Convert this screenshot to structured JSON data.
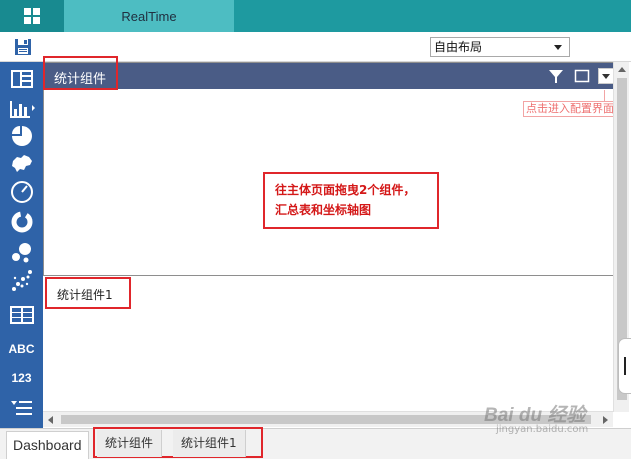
{
  "topbar": {
    "tab_label": "RealTime"
  },
  "toolbar": {
    "layout_value": "自由布局"
  },
  "sidebar": {
    "items": [
      {
        "icon": "table-layout-icon"
      },
      {
        "icon": "bar-chart-icon"
      },
      {
        "icon": "pie-chart-icon"
      },
      {
        "icon": "map-icon"
      },
      {
        "icon": "gauge-icon"
      },
      {
        "icon": "ring-chart-icon"
      },
      {
        "icon": "bubble-chart-icon"
      },
      {
        "icon": "scatter-chart-icon"
      },
      {
        "icon": "grid-table-icon"
      },
      {
        "label": "ABC"
      },
      {
        "label": "123"
      },
      {
        "icon": "list-filter-icon"
      }
    ]
  },
  "widget1": {
    "title": "统计组件",
    "config_hint": "点击进入配置界面",
    "note_line1": "往主体页面拖曳2个组件，",
    "note_line2": "汇总表和坐标轴图"
  },
  "widget2": {
    "title": "统计组件1"
  },
  "bottom_tabs": {
    "dashboard": "Dashboard",
    "tab1": "统计组件",
    "tab2": "统计组件1"
  },
  "watermark": {
    "text": "Bai du 经验",
    "sub": "jingyan.baidu.com"
  },
  "colors": {
    "topbar": "#1e9aa0",
    "sidebar": "#2f63a8",
    "widget_header": "#4a5c86",
    "highlight": "#e0262b"
  }
}
